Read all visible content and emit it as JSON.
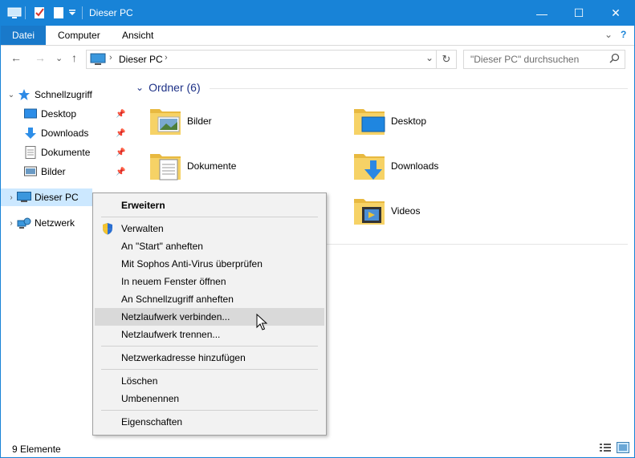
{
  "window": {
    "title": "Dieser PC",
    "controls": {
      "minimize": "—",
      "maximize": "☐",
      "close": "✕"
    }
  },
  "ribbon": {
    "tabs": [
      {
        "label": "Datei"
      },
      {
        "label": "Computer"
      },
      {
        "label": "Ansicht"
      }
    ],
    "collapse_glyph": "⌄",
    "help_glyph": "?"
  },
  "address": {
    "crumb": "Dieser PC",
    "crumb_sep": "›",
    "dropdown_glyph": "⌄",
    "refresh_glyph": "↻"
  },
  "search": {
    "placeholder": "\"Dieser PC\" durchsuchen"
  },
  "nav_buttons": {
    "back": "←",
    "forward": "→",
    "recent": "⌄",
    "up": "↑"
  },
  "navpane": {
    "quick_access": "Schnellzugriff",
    "items": [
      {
        "label": "Desktop"
      },
      {
        "label": "Downloads"
      },
      {
        "label": "Dokumente"
      },
      {
        "label": "Bilder"
      }
    ],
    "this_pc": "Dieser PC",
    "network": "Netzwerk"
  },
  "content": {
    "group_header": "Ordner (6)",
    "folders": [
      {
        "label": "Bilder"
      },
      {
        "label": "Desktop"
      },
      {
        "label": "Dokumente"
      },
      {
        "label": "Downloads"
      },
      {
        "label": "Videos"
      }
    ]
  },
  "context_menu": {
    "items": [
      {
        "label": "Erweitern"
      },
      {
        "label": "Verwalten"
      },
      {
        "label": "An \"Start\" anheften"
      },
      {
        "label": "Mit Sophos Anti-Virus überprüfen"
      },
      {
        "label": "In neuem Fenster öffnen"
      },
      {
        "label": "An Schnellzugriff anheften"
      },
      {
        "label": "Netzlaufwerk verbinden..."
      },
      {
        "label": "Netzlaufwerk trennen..."
      },
      {
        "label": "Netzwerkadresse hinzufügen"
      },
      {
        "label": "Löschen"
      },
      {
        "label": "Umbenennen"
      },
      {
        "label": "Eigenschaften"
      }
    ]
  },
  "status": {
    "count": "9 Elemente"
  },
  "colors": {
    "accent": "#1883d7",
    "folder": "#f3c855",
    "menu_bg": "#f2f2f2",
    "menu_hover": "#d9d9d9",
    "group_header": "#1e3287"
  }
}
